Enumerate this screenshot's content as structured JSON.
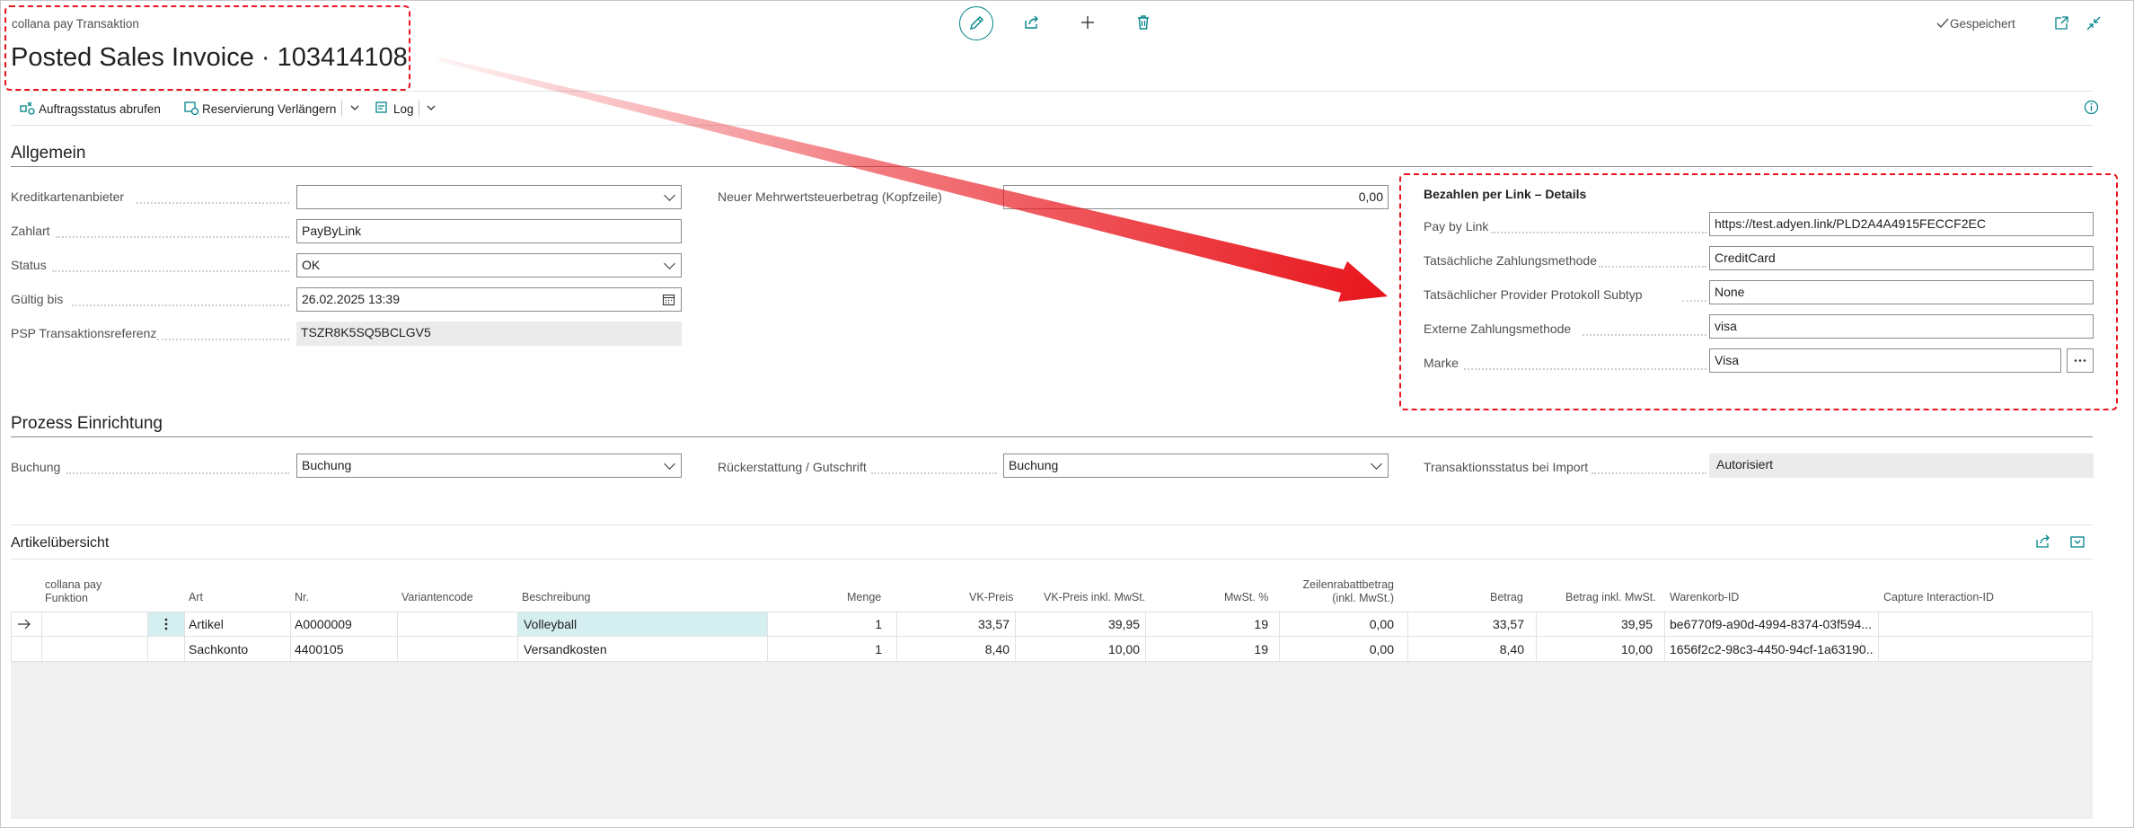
{
  "header": {
    "caption": "collana pay Transaktion",
    "title": "Posted Sales Invoice · 103414108",
    "saved_status": "Gespeichert"
  },
  "actions": {
    "order_status": "Auftragsstatus abrufen",
    "extend_reservation": "Reservierung Verlängern",
    "log": "Log"
  },
  "general": {
    "title": "Allgemein",
    "fields": {
      "card_provider": {
        "label": "Kreditkartenanbieter",
        "value": ""
      },
      "payment_type": {
        "label": "Zahlart",
        "value": "PayByLink"
      },
      "status": {
        "label": "Status",
        "value": "OK"
      },
      "valid_until": {
        "label": "Gültig bis",
        "value": "26.02.2025 13:39"
      },
      "psp_reference": {
        "label": "PSP Transaktionsreferenz",
        "value": "TSZR8K5SQ5BCLGV5"
      },
      "new_vat": {
        "label": "Neuer Mehrwertsteuerbetrag (Kopfzeile)",
        "value": "0,00"
      }
    }
  },
  "paylink": {
    "title": "Bezahlen per Link – Details",
    "fields": {
      "pay_by_link": {
        "label": "Pay by Link",
        "value": "https://test.adyen.link/PLD2A4A4915FECCF2EC"
      },
      "actual_method": {
        "label": "Tatsächliche Zahlungsmethode",
        "value": "CreditCard"
      },
      "provider_subtype": {
        "label": "Tatsächlicher Provider Protokoll Subtyp",
        "value": "None"
      },
      "external_method": {
        "label": "Externe Zahlungsmethode",
        "value": "visa"
      },
      "brand": {
        "label": "Marke",
        "value": "Visa"
      }
    }
  },
  "process": {
    "title": "Prozess Einrichtung",
    "fields": {
      "posting": {
        "label": "Buchung",
        "value": "Buchung"
      },
      "refund": {
        "label": "Rückerstattung / Gutschrift",
        "value": "Buchung"
      },
      "import_status": {
        "label": "Transaktionsstatus bei Import",
        "value": "Autorisiert"
      }
    }
  },
  "items": {
    "title": "Artikelübersicht",
    "columns": {
      "function_1": "collana pay",
      "function_2": "Funktion",
      "type": "Art",
      "no": "Nr.",
      "variant": "Variantencode",
      "description": "Beschreibung",
      "qty": "Menge",
      "price": "VK-Preis",
      "price_incl": "VK-Preis inkl. MwSt.",
      "vat": "MwSt. %",
      "discount_1": "Zeilenrabattbetrag",
      "discount_2": "(inkl. MwSt.)",
      "amount": "Betrag",
      "amount_incl": "Betrag inkl. MwSt.",
      "cart_id": "Warenkorb-ID",
      "capture_id": "Capture Interaction-ID"
    },
    "rows": [
      {
        "type": "Artikel",
        "no": "A0000009",
        "variant": "",
        "description": "Volleyball",
        "qty": "1",
        "price": "33,57",
        "price_incl": "39,95",
        "vat": "19",
        "discount": "0,00",
        "amount": "33,57",
        "amount_incl": "39,95",
        "cart_id": "be6770f9-a90d-4994-8374-03f594...",
        "capture_id": ""
      },
      {
        "type": "Sachkonto",
        "no": "4400105",
        "variant": "",
        "description": "Versandkosten",
        "qty": "1",
        "price": "8,40",
        "price_incl": "10,00",
        "vat": "19",
        "discount": "0,00",
        "amount": "8,40",
        "amount_incl": "10,00",
        "cart_id": "1656f2c2-98c3-4450-94cf-1a63190...",
        "capture_id": ""
      }
    ]
  },
  "colors": {
    "accent": "#008489",
    "annotation": "#e8141b",
    "selected_cell": "#d5eff0"
  }
}
